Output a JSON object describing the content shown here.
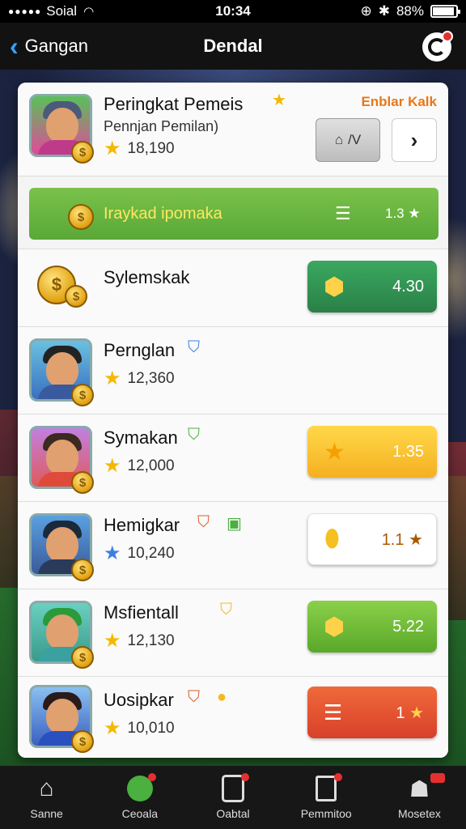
{
  "status_bar": {
    "carrier": "Soial",
    "time": "10:34",
    "battery": "88%"
  },
  "nav": {
    "back_label": "Gangan",
    "title": "Dendal"
  },
  "header": {
    "name": "Peringkat Pemeis",
    "subtitle": "Pennjan Pemilan)",
    "score": "18,190",
    "tag": "Enblar Kalk",
    "button_label": "/V"
  },
  "banner": {
    "label": "Iraykad ipomaka",
    "value": "1.3"
  },
  "rows": [
    {
      "name": "Sylemskak",
      "score": "",
      "action": "4.30"
    },
    {
      "name": "Pernglan",
      "score": "12,360",
      "action": ""
    },
    {
      "name": "Symakan",
      "score": "12,000",
      "action": "1.35"
    },
    {
      "name": "Hemigkar",
      "score": "10,240",
      "action": "1.1"
    },
    {
      "name": "Msfientall",
      "score": "12,130",
      "action": "5.22"
    },
    {
      "name": "Uosipkar",
      "score": "10,010",
      "action": "1"
    }
  ],
  "tabs": [
    "Sanne",
    "Ceoala",
    "Oabtal",
    "Pemmitoo",
    "Mosetex"
  ],
  "colors": {
    "accent": "#3aa0ff",
    "green": "#2a8048",
    "lime": "#5aa82a",
    "yellow": "#f5b020",
    "red": "#d8402a"
  }
}
